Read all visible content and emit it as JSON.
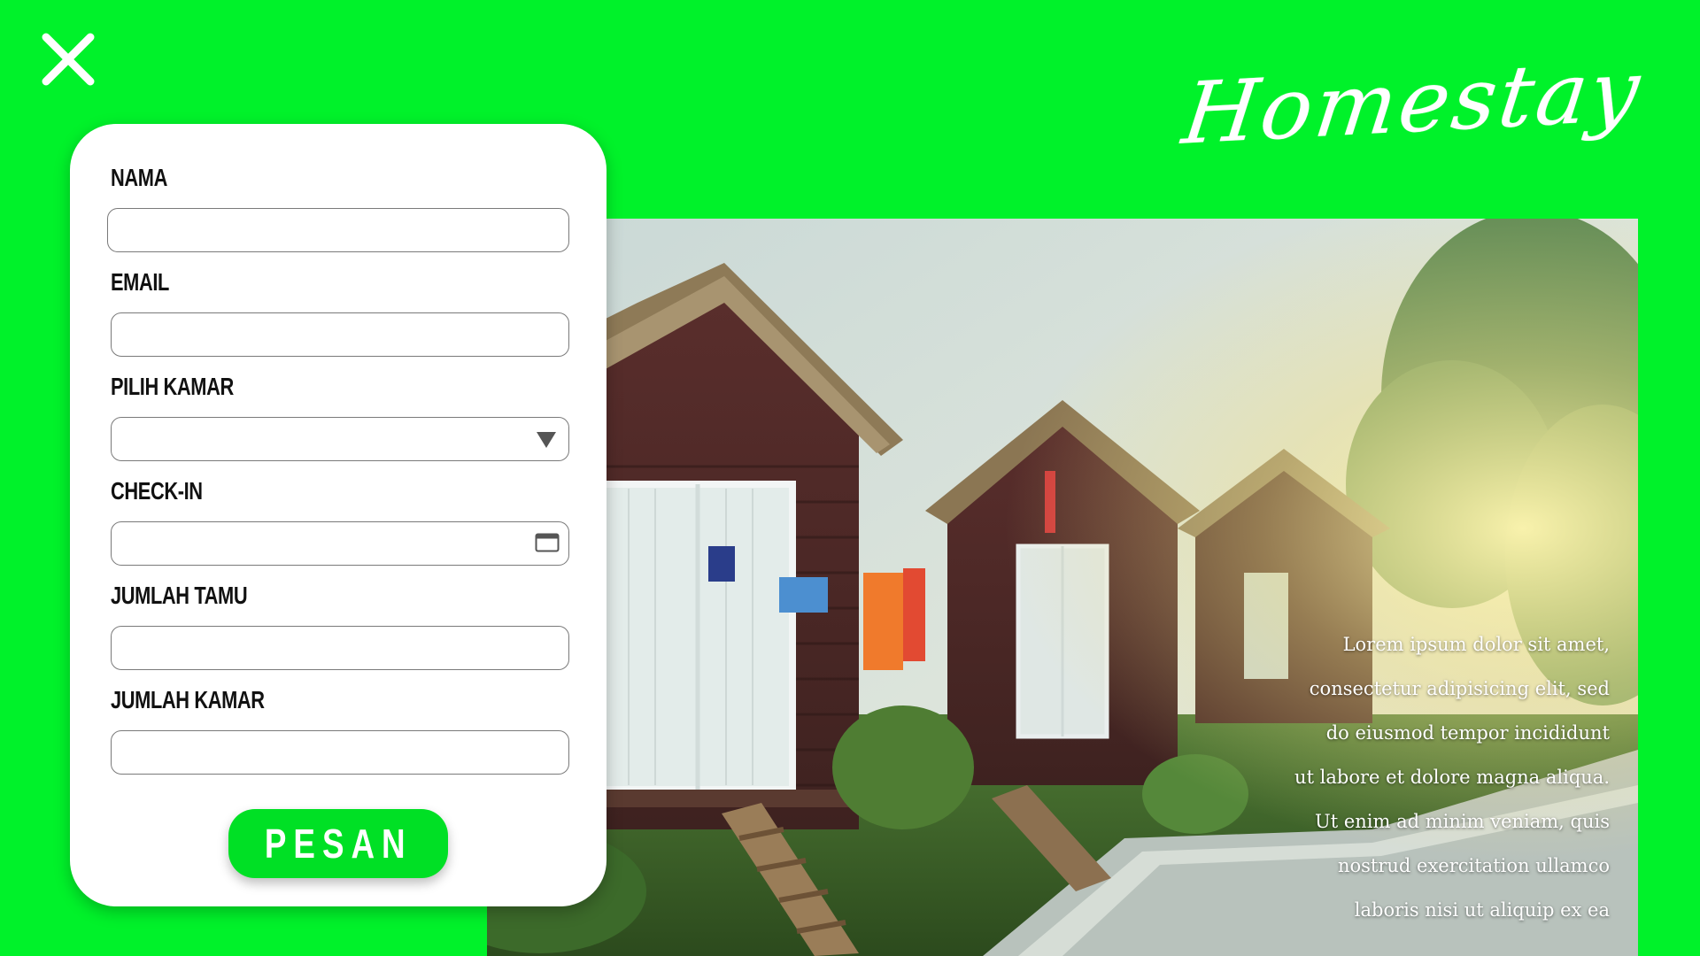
{
  "app": {
    "brand": "Homestay",
    "accent_color": "#00F22A",
    "close_icon": "close-icon"
  },
  "form": {
    "fields": [
      {
        "label": "NAMA",
        "type": "text",
        "value": ""
      },
      {
        "label": "EMAIL",
        "type": "text",
        "value": ""
      },
      {
        "label": "PILIH KAMAR",
        "type": "select",
        "value": "",
        "icon": "chevron-down-icon"
      },
      {
        "label": "CHECK-IN",
        "type": "date",
        "value": "",
        "icon": "calendar-icon"
      },
      {
        "label": "JUMLAH TAMU",
        "type": "text",
        "value": ""
      },
      {
        "label": "JUMLAH KAMAR",
        "type": "text",
        "value": ""
      }
    ],
    "submit_label": "PESAN"
  },
  "hero": {
    "image": "homestay-cabins-photo",
    "caption_lines": [
      "Lorem ipsum dolor sit amet,",
      "consectetur adipisicing elit, sed",
      "do eiusmod tempor incididunt",
      "ut labore et dolore magna aliqua.",
      "Ut enim ad minim veniam, quis",
      "nostrud exercitation ullamco",
      "laboris nisi ut aliquip ex ea"
    ]
  }
}
